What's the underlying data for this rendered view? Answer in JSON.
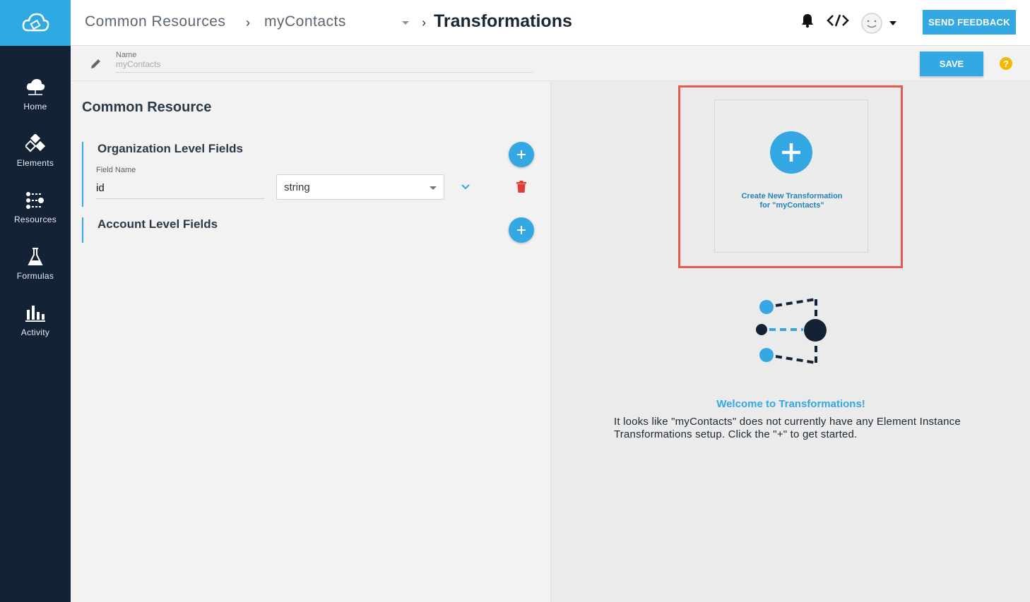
{
  "header": {
    "breadcrumb_root": "Common Resources",
    "breadcrumb_resource": "myContacts",
    "page_title": "Transformations",
    "feedback_label": "SEND FEEDBACK"
  },
  "sidebar": {
    "items": [
      {
        "label": "Home",
        "icon": "cloud-icon"
      },
      {
        "label": "Elements",
        "icon": "elements-icon"
      },
      {
        "label": "Resources",
        "icon": "resources-icon"
      },
      {
        "label": "Formulas",
        "icon": "flask-icon"
      },
      {
        "label": "Activity",
        "icon": "bar-chart-icon"
      }
    ]
  },
  "subheader": {
    "name_label": "Name",
    "name_value": "myContacts",
    "save_label": "SAVE",
    "help_symbol": "?"
  },
  "left_panel": {
    "title": "Common Resource",
    "organization_section": {
      "title": "Organization Level Fields",
      "field_label": "Field Name",
      "field_value": "id",
      "type_value": "string"
    },
    "account_section": {
      "title": "Account Level Fields"
    }
  },
  "right_panel": {
    "create_text": "Create New Transformation for \"myContacts\"",
    "welcome_title": "Welcome to Transformations!",
    "welcome_body": "It looks like \"myContacts\" does not currently have any Element Instance Transformations setup. Click the \"+\" to get started."
  },
  "colors": {
    "accent": "#33a8e3",
    "sidebar_bg": "#132234",
    "highlight": "#e75b4f",
    "delete": "#e53935"
  }
}
